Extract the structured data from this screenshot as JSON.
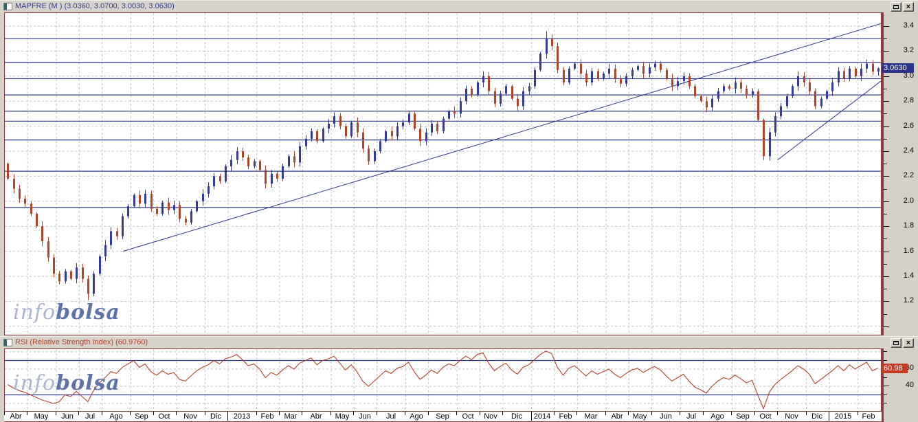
{
  "colors": {
    "up_candle": "#333a99",
    "down_candle": "#b2432b",
    "rsi_line": "#b2432b",
    "frame": "#8a3b3b",
    "grid": "#c2c2c2",
    "drawn_line": "#2c3a8c",
    "price_tag_bg": "#2b3590",
    "rsi_tag_bg": "#c23b22",
    "title1_color": "#333a99",
    "title2_color": "#b2432b"
  },
  "price_panel": {
    "title": "MAPFRE (M ) (3.0360, 3.0700, 3.0030, 3.0630)",
    "price_tag": "3.0630",
    "restore_button": "restore",
    "close_button": "close"
  },
  "rsi_panel": {
    "title": "RSI (Relative Strength Index) (60.9760)",
    "value_tag": "60.98",
    "restore_button": "restore",
    "close_button": "close"
  },
  "watermark": {
    "light": "info",
    "bold": "bolsa"
  },
  "x_axis": {
    "months": [
      {
        "label": "Abr",
        "weeks": 4
      },
      {
        "label": "May",
        "weeks": 5
      },
      {
        "label": "Jun",
        "weeks": 4
      },
      {
        "label": "Jul",
        "weeks": 4
      },
      {
        "label": "Ago",
        "weeks": 5
      },
      {
        "label": "Sep",
        "weeks": 4
      },
      {
        "label": "Oct",
        "weeks": 4
      },
      {
        "label": "Nov",
        "weeks": 5
      },
      {
        "label": "Dic",
        "weeks": 4
      },
      {
        "label": "2013",
        "weeks": 5
      },
      {
        "label": "Feb",
        "weeks": 4
      },
      {
        "label": "Mar",
        "weeks": 4
      },
      {
        "label": "Abr",
        "weeks": 5
      },
      {
        "label": "May",
        "weeks": 4
      },
      {
        "label": "Jun",
        "weeks": 4
      },
      {
        "label": "Jul",
        "weeks": 5
      },
      {
        "label": "Ago",
        "weeks": 4
      },
      {
        "label": "Sep",
        "weeks": 5
      },
      {
        "label": "Oct",
        "weeks": 4
      },
      {
        "label": "Nov",
        "weeks": 4
      },
      {
        "label": "Dic",
        "weeks": 5
      },
      {
        "label": "2014",
        "weeks": 4
      },
      {
        "label": "Feb",
        "weeks": 4
      },
      {
        "label": "Mar",
        "weeks": 5
      },
      {
        "label": "Abr",
        "weeks": 4
      },
      {
        "label": "May",
        "weeks": 4
      },
      {
        "label": "Jun",
        "weeks": 5
      },
      {
        "label": "Jul",
        "weeks": 4
      },
      {
        "label": "Ago",
        "weeks": 5
      },
      {
        "label": "Sep",
        "weeks": 4
      },
      {
        "label": "Oct",
        "weeks": 4
      },
      {
        "label": "Nov",
        "weeks": 5
      },
      {
        "label": "Dic",
        "weeks": 4
      },
      {
        "label": "2015",
        "weeks": 5
      },
      {
        "label": "Feb",
        "weeks": 4
      }
    ]
  },
  "chart_data": [
    {
      "type": "candlestick",
      "name": "MAPFRE weekly",
      "title": "MAPFRE (M )",
      "last_ohlc": {
        "open": 3.036,
        "high": 3.07,
        "low": 3.003,
        "close": 3.063
      },
      "open0": 2.3,
      "weekly_closes": [
        2.18,
        2.1,
        2.02,
        1.98,
        1.9,
        1.8,
        1.68,
        1.55,
        1.42,
        1.36,
        1.44,
        1.38,
        1.47,
        1.38,
        1.26,
        1.42,
        1.56,
        1.65,
        1.76,
        1.72,
        1.88,
        1.96,
        2.05,
        1.98,
        2.06,
        1.94,
        1.9,
        1.99,
        1.93,
        1.97,
        1.86,
        1.83,
        1.92,
        2.0,
        2.06,
        2.12,
        2.2,
        2.16,
        2.28,
        2.33,
        2.4,
        2.35,
        2.28,
        2.32,
        2.25,
        2.14,
        2.22,
        2.18,
        2.28,
        2.36,
        2.31,
        2.44,
        2.5,
        2.56,
        2.48,
        2.58,
        2.62,
        2.68,
        2.6,
        2.52,
        2.63,
        2.55,
        2.42,
        2.32,
        2.4,
        2.48,
        2.56,
        2.52,
        2.6,
        2.63,
        2.7,
        2.58,
        2.48,
        2.55,
        2.62,
        2.56,
        2.66,
        2.72,
        2.7,
        2.8,
        2.9,
        2.85,
        2.95,
        3.0,
        2.88,
        2.78,
        2.86,
        2.92,
        2.82,
        2.76,
        2.88,
        2.92,
        3.05,
        3.18,
        3.3,
        3.24,
        3.05,
        2.95,
        3.06,
        3.1,
        3.02,
        2.95,
        3.04,
        2.98,
        3.02,
        3.06,
        2.98,
        2.94,
        3.0,
        3.05,
        3.08,
        3.02,
        3.07,
        3.1,
        3.05,
        2.98,
        2.92,
        2.96,
        3.0,
        2.92,
        2.84,
        2.8,
        2.75,
        2.82,
        2.88,
        2.92,
        2.9,
        2.95,
        2.9,
        2.85,
        2.88,
        2.65,
        2.36,
        2.55,
        2.68,
        2.76,
        2.84,
        2.92,
        3.0,
        2.95,
        2.88,
        2.76,
        2.82,
        2.88,
        2.95,
        3.04,
        2.98,
        3.06,
        3.0,
        3.06,
        3.1,
        3.036,
        3.063
      ],
      "extremes": {
        "14": {
          "low": 1.21
        },
        "94": {
          "high": 3.36
        },
        "132": {
          "low": 2.33
        },
        "152": {
          "high": 3.07,
          "low": 3.003
        }
      },
      "y_axis": {
        "tick_labels": [
          "3.4",
          "3.2",
          "3.0",
          "2.8",
          "2.6",
          "2.4",
          "2.2",
          "2.0",
          "1.8",
          "1.6",
          "1.4",
          "1.2"
        ],
        "label_step": 0.2,
        "minor_step": 0.1,
        "ylim": [
          0.93,
          3.47
        ],
        "grid": true
      },
      "support_lines": [
        3.3,
        3.11,
        2.98,
        2.85,
        2.72,
        2.64,
        2.49,
        2.24,
        1.95
      ],
      "trendlines": [
        {
          "x1_frac": 0.135,
          "price1": 1.6,
          "x2_frac": 1.0,
          "price2": 3.42
        },
        {
          "x1_frac": 0.882,
          "price1": 2.33,
          "x2_frac": 1.0,
          "price2": 2.96
        }
      ]
    },
    {
      "type": "line",
      "name": "RSI",
      "title": "RSI (Relative Strength Index)",
      "last_value": 60.976,
      "values": [
        42,
        38,
        35,
        33,
        30,
        27,
        24,
        22,
        20,
        22,
        30,
        28,
        34,
        28,
        22,
        35,
        44,
        50,
        57,
        55,
        62,
        66,
        70,
        62,
        66,
        57,
        53,
        58,
        54,
        56,
        48,
        46,
        52,
        58,
        62,
        65,
        70,
        66,
        72,
        74,
        77,
        71,
        64,
        66,
        60,
        50,
        56,
        53,
        59,
        64,
        60,
        67,
        70,
        73,
        65,
        70,
        72,
        75,
        67,
        59,
        65,
        57,
        46,
        40,
        46,
        52,
        58,
        55,
        61,
        63,
        68,
        57,
        48,
        53,
        59,
        55,
        62,
        66,
        64,
        70,
        75,
        71,
        77,
        79,
        67,
        58,
        63,
        67,
        59,
        54,
        62,
        65,
        71,
        77,
        81,
        78,
        62,
        53,
        61,
        64,
        58,
        52,
        58,
        54,
        57,
        60,
        54,
        50,
        55,
        59,
        61,
        56,
        60,
        63,
        59,
        52,
        46,
        50,
        54,
        46,
        39,
        36,
        32,
        40,
        46,
        50,
        48,
        53,
        49,
        44,
        47,
        30,
        14,
        33,
        42,
        48,
        53,
        58,
        64,
        60,
        54,
        43,
        48,
        53,
        58,
        64,
        58,
        65,
        60,
        64,
        68,
        58,
        60.976
      ],
      "y_axis": {
        "tick_labels": [
          "60",
          "40"
        ],
        "labeled_levels": [
          60,
          40
        ],
        "minor_levels": [
          20,
          30,
          50,
          70,
          80
        ],
        "dashed_levels": [
          20,
          40,
          60,
          80
        ],
        "band_levels": [
          30,
          70
        ],
        "ylim": [
          12,
          84
        ],
        "grid": true
      }
    }
  ]
}
